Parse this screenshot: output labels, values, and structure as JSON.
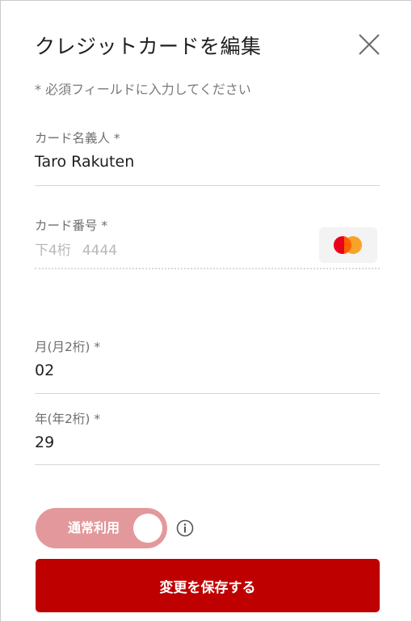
{
  "dialog": {
    "title": "クレジットカードを編集",
    "required_note": "* 必須フィールドに入力してください"
  },
  "fields": {
    "cardholder": {
      "label": "カード名義人 *",
      "value": "Taro Rakuten"
    },
    "card_number": {
      "label": "カード番号 *",
      "prefix": "下4桁",
      "last4": "4444",
      "brand_icon": "mastercard-icon"
    },
    "month": {
      "label": "月(月2桁) *",
      "value": "02"
    },
    "year": {
      "label": "年(年2桁) *",
      "value": "29"
    }
  },
  "toggle": {
    "label": "通常利用",
    "state": "on"
  },
  "actions": {
    "save_label": "変更を保存する"
  },
  "colors": {
    "accent": "#bf0000",
    "toggle_bg": "#e3999b",
    "text": "#1f1f1f",
    "muted": "#6e6e6e"
  }
}
